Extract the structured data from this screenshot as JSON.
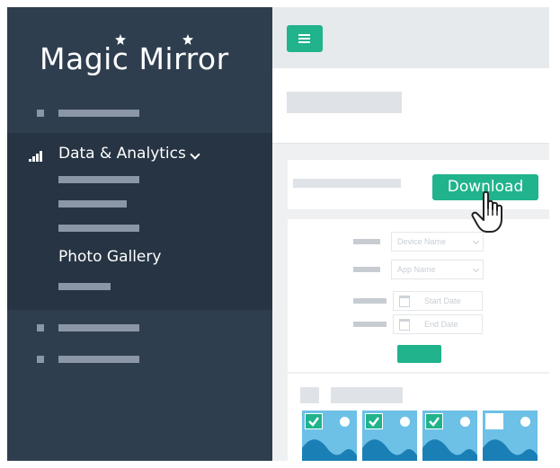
{
  "sidebar": {
    "logo_text": "Magic Mirror",
    "active_menu_label": "Data & Analytics",
    "photo_gallery_label": "Photo Gallery"
  },
  "toolbar": {
    "download_label": "Download"
  },
  "filter_form": {
    "device_placeholder": "Device Name",
    "app_placeholder": "App Name",
    "start_date_placeholder": "Start Date",
    "end_date_placeholder": "End Date"
  },
  "gallery": {
    "thumbnails": [
      {
        "selected": true
      },
      {
        "selected": true
      },
      {
        "selected": true
      },
      {
        "selected": false
      }
    ]
  },
  "colors": {
    "sidebar_bg": "#2f3e4f",
    "submenu_bg": "#263443",
    "accent": "#20b38c",
    "photo_sky": "#6dc0e6",
    "photo_hill": "#1a7fb5"
  },
  "icons": [
    "hamburger-icon",
    "signal-bars-icon",
    "chevron-down-icon",
    "calendar-icon",
    "checkmark-icon",
    "hand-pointer-icon"
  ]
}
